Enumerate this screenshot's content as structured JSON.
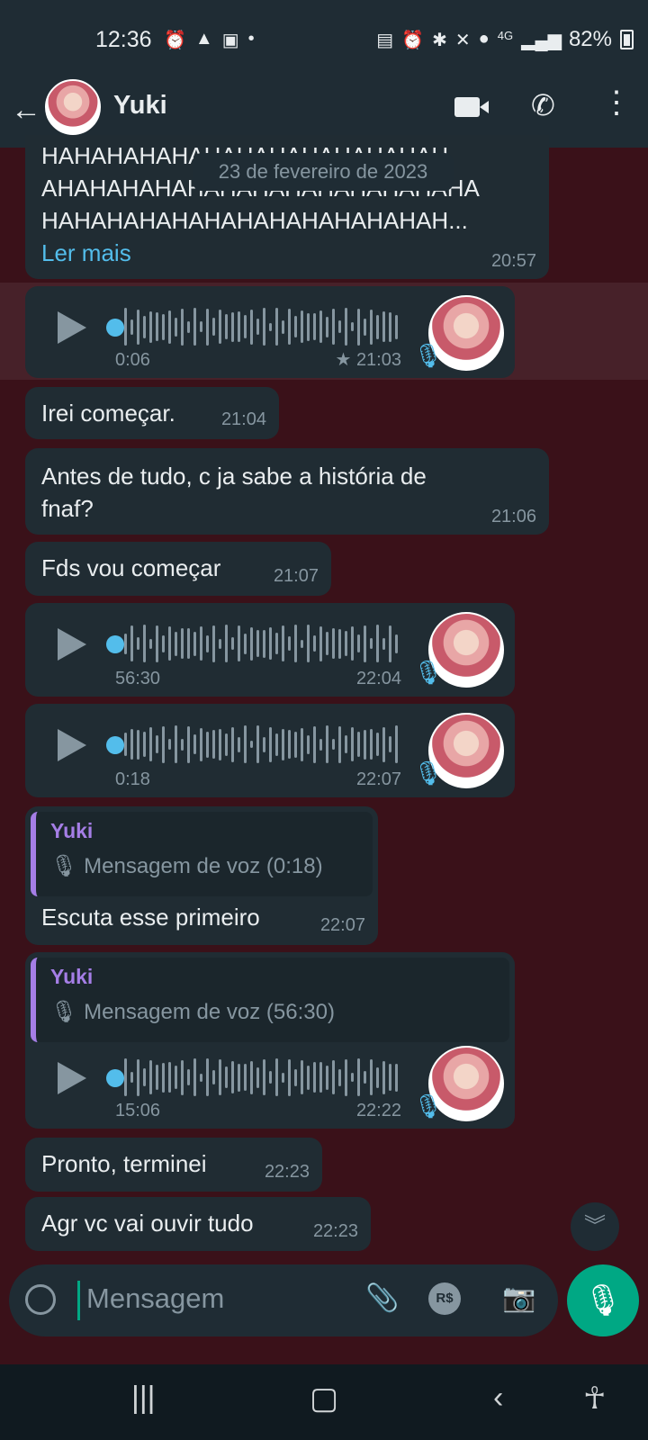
{
  "status_bar": {
    "time": "12:36",
    "left_icons": [
      "alarm-icon",
      "nav-icon",
      "image-icon",
      "dot-icon"
    ],
    "right_icons": [
      "nfc-icon",
      "alarm-icon",
      "bluetooth-icon",
      "mute-icon",
      "location-icon",
      "4g-icon",
      "signal-icon"
    ],
    "battery": "82%"
  },
  "header": {
    "contact_name": "Yuki"
  },
  "date_chip": "23 de fevereiro de 2023",
  "messages": {
    "m1": {
      "line1": "HAHAHAHAHAHAHAHAHAHAHAHAH",
      "line2": "AHAHAHAHAHAHAHAHAHAHAHAHAHA",
      "line3": "HAHAHAHAHAHAHAHAHAHAHAHAH...",
      "read_more": "Ler mais",
      "time": "20:57"
    },
    "v1": {
      "duration": "0:06",
      "time": "21:03",
      "starred": true
    },
    "m2": {
      "text": "Irei começar.",
      "time": "21:04"
    },
    "m3": {
      "line1": "Antes de tudo, c ja sabe a história de",
      "line2": "fnaf?",
      "time": "21:06"
    },
    "m4": {
      "text": "Fds vou começar",
      "time": "21:07"
    },
    "v2": {
      "duration": "56:30",
      "time": "22:04"
    },
    "v3": {
      "duration": "0:18",
      "time": "22:07"
    },
    "q1": {
      "quote_name": "Yuki",
      "quote_text": "Mensagem de voz (0:18)",
      "text": "Escuta esse primeiro",
      "time": "22:07"
    },
    "q2": {
      "quote_name": "Yuki",
      "quote_text": "Mensagem de voz (56:30)",
      "duration": "15:06",
      "time": "22:22"
    },
    "m5": {
      "text": "Pronto, terminei",
      "time": "22:23"
    },
    "m6": {
      "text": "Agr vc vai ouvir tudo",
      "time": "22:23"
    }
  },
  "input": {
    "placeholder": "Mensagem",
    "currency_label": "R$"
  },
  "colors": {
    "accent": "#00a884",
    "link": "#53bdeb",
    "quote": "#a57ee6",
    "bubble": "#202c33",
    "wallpaper": "#3a1119"
  }
}
